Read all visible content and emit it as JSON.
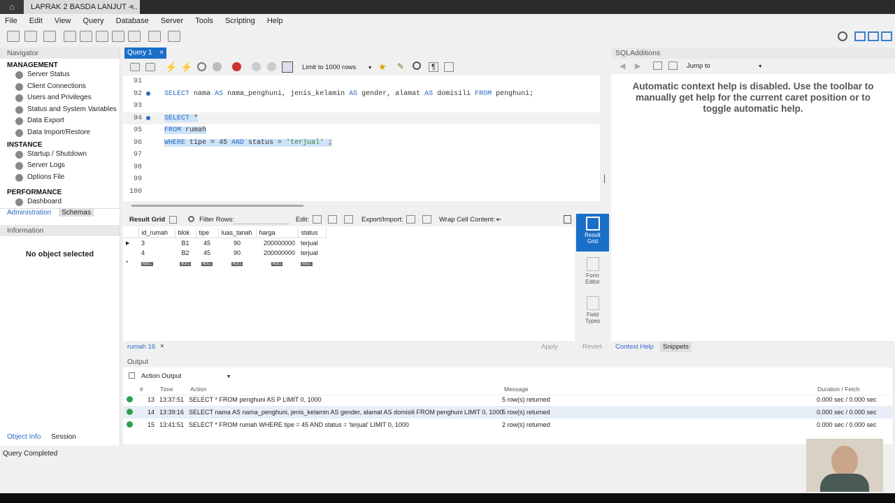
{
  "window": {
    "tab_title": "LAPRAK 2 BASDA LANJUT -...",
    "close": "×"
  },
  "menu": [
    "File",
    "Edit",
    "View",
    "Query",
    "Database",
    "Server",
    "Tools",
    "Scripting",
    "Help"
  ],
  "navigator": {
    "title": "Navigator",
    "management_label": "MANAGEMENT",
    "management": [
      "Server Status",
      "Client Connections",
      "Users and Privileges",
      "Status and System Variables",
      "Data Export",
      "Data Import/Restore"
    ],
    "instance_label": "INSTANCE",
    "instance": [
      "Startup / Shutdown",
      "Server Logs",
      "Options File"
    ],
    "performance_label": "PERFORMANCE",
    "performance": [
      "Dashboard"
    ],
    "tabs": [
      "Administration",
      "Schemas"
    ],
    "information_title": "Information",
    "no_object": "No object selected",
    "bottom_tabs": [
      "Object Info",
      "Session"
    ]
  },
  "query_tab": {
    "label": "Query 1",
    "close": "×",
    "limit": "Limit to 1000 rows"
  },
  "editor": {
    "lines": [
      {
        "n": "91",
        "code": ""
      },
      {
        "n": "92",
        "code": "SELECT nama AS nama_penghuni, jenis_kelamin AS gender, alamat AS domisili FROM penghuni;"
      },
      {
        "n": "93",
        "code": ""
      },
      {
        "n": "94",
        "code": "SELECT *"
      },
      {
        "n": "95",
        "code": "FROM rumah"
      },
      {
        "n": "96",
        "code": "WHERE tipe = 45 AND status = 'terjual' ;"
      },
      {
        "n": "97",
        "code": ""
      },
      {
        "n": "98",
        "code": ""
      },
      {
        "n": "99",
        "code": ""
      },
      {
        "n": "100",
        "code": ""
      }
    ]
  },
  "result": {
    "toolbar": {
      "result_grid": "Result Grid",
      "filter_rows": "Filter Rows:",
      "edit": "Edit:",
      "export_import": "Export/Import:",
      "wrap": "Wrap Cell Content:"
    },
    "columns": [
      "id_rumah",
      "blok",
      "tipe",
      "luas_tanah",
      "harga",
      "status"
    ],
    "rows": [
      [
        "3",
        "B1",
        "45",
        "90",
        "200000000",
        "terjual"
      ],
      [
        "4",
        "B2",
        "45",
        "90",
        "200000000",
        "terjual"
      ]
    ],
    "null_label": "NULL",
    "tab_label": "rumah 16",
    "apply": "Apply",
    "revert": "Revert"
  },
  "side_buttons": [
    {
      "label": "Result Grid"
    },
    {
      "label": "Form Editor"
    },
    {
      "label": "Field Types"
    }
  ],
  "sql_additions": {
    "title": "SQLAdditions",
    "jump_to": "Jump to",
    "help_text": "Automatic context help is disabled. Use the toolbar to manually get help for the current caret position or to toggle automatic help.",
    "tabs": [
      "Context Help",
      "Snippets"
    ]
  },
  "output": {
    "title": "Output",
    "mode": "Action Output",
    "headers": {
      "num": "#",
      "time": "Time",
      "action": "Action",
      "message": "Message",
      "duration": "Duration / Fetch"
    },
    "rows": [
      {
        "num": "13",
        "time": "13:37:51",
        "action": "SELECT * FROM penghuni AS P LIMIT 0, 1000",
        "message": "5 row(s) returned",
        "duration": "0.000 sec / 0.000 sec"
      },
      {
        "num": "14",
        "time": "13:39:16",
        "action": "SELECT nama AS nama_penghuni, jenis_kelamin AS gender, alamat AS domisili FROM penghuni LIMIT 0, 1000",
        "message": "5 row(s) returned",
        "duration": "0.000 sec / 0.000 sec"
      },
      {
        "num": "15",
        "time": "13:41:51",
        "action": "SELECT * FROM rumah WHERE tipe = 45 AND status = 'terjual' LIMIT 0, 1000",
        "message": "2 row(s) returned",
        "duration": "0.000 sec / 0.000 sec"
      }
    ]
  },
  "status": "Query Completed",
  "colors": {
    "accent": "#1a6fc9",
    "keyword": "#2b69c5",
    "ok": "#2aa04a"
  }
}
